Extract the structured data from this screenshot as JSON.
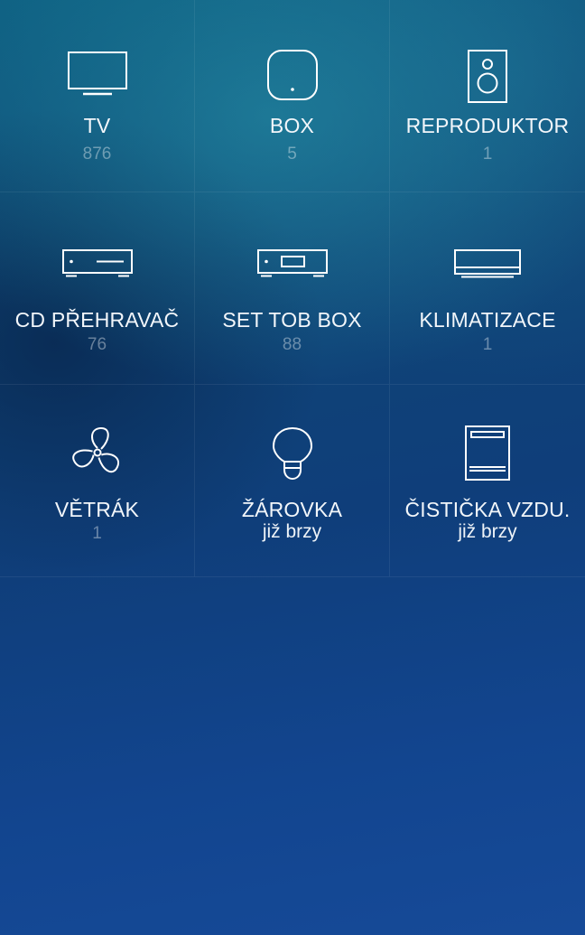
{
  "devices": [
    {
      "label": "TV",
      "count": "876",
      "icon": "tv-icon"
    },
    {
      "label": "BOX",
      "count": "5",
      "icon": "box-icon"
    },
    {
      "label": "REPRODUKTOR",
      "count": "1",
      "icon": "speaker-icon"
    },
    {
      "label": "CD PŘEHRAVAČ",
      "count": "76",
      "icon": "cd-player-icon"
    },
    {
      "label": "SET TOB BOX",
      "count": "88",
      "icon": "set-top-box-icon"
    },
    {
      "label": "KLIMATIZACE",
      "count": "1",
      "icon": "air-conditioner-icon"
    },
    {
      "label": "VĚTRÁK",
      "count": "1",
      "icon": "fan-icon"
    },
    {
      "label": "ŽÁROVKA",
      "soon": "již brzy",
      "icon": "light-bulb-icon"
    },
    {
      "label": "ČISTIČKA VZDU.",
      "soon": "již brzy",
      "icon": "air-purifier-icon"
    }
  ],
  "colors": {
    "background_top": "#0d5d80",
    "background_bottom": "#164a98",
    "label": "#f2f6fa",
    "count": "rgba(255,255,255,0.38)"
  }
}
